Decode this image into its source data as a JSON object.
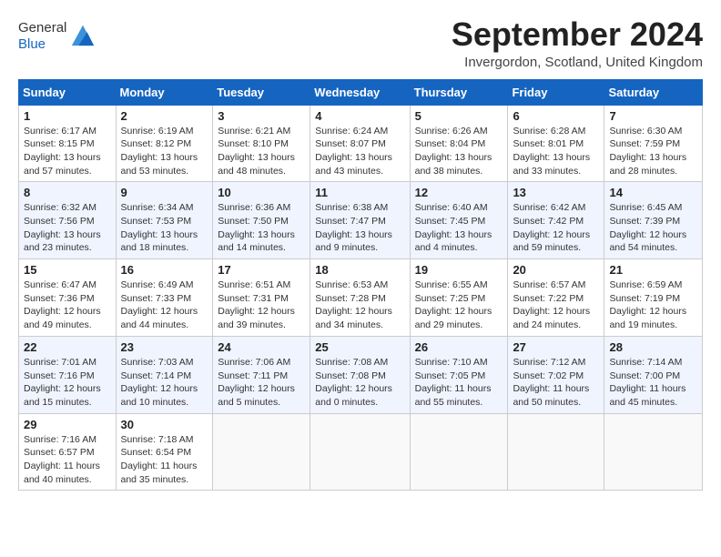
{
  "header": {
    "logo_general": "General",
    "logo_blue": "Blue",
    "title": "September 2024",
    "subtitle": "Invergordon, Scotland, United Kingdom"
  },
  "calendar": {
    "days_of_week": [
      "Sunday",
      "Monday",
      "Tuesday",
      "Wednesday",
      "Thursday",
      "Friday",
      "Saturday"
    ],
    "weeks": [
      [
        {
          "day": "1",
          "info": "Sunrise: 6:17 AM\nSunset: 8:15 PM\nDaylight: 13 hours\nand 57 minutes."
        },
        {
          "day": "2",
          "info": "Sunrise: 6:19 AM\nSunset: 8:12 PM\nDaylight: 13 hours\nand 53 minutes."
        },
        {
          "day": "3",
          "info": "Sunrise: 6:21 AM\nSunset: 8:10 PM\nDaylight: 13 hours\nand 48 minutes."
        },
        {
          "day": "4",
          "info": "Sunrise: 6:24 AM\nSunset: 8:07 PM\nDaylight: 13 hours\nand 43 minutes."
        },
        {
          "day": "5",
          "info": "Sunrise: 6:26 AM\nSunset: 8:04 PM\nDaylight: 13 hours\nand 38 minutes."
        },
        {
          "day": "6",
          "info": "Sunrise: 6:28 AM\nSunset: 8:01 PM\nDaylight: 13 hours\nand 33 minutes."
        },
        {
          "day": "7",
          "info": "Sunrise: 6:30 AM\nSunset: 7:59 PM\nDaylight: 13 hours\nand 28 minutes."
        }
      ],
      [
        {
          "day": "8",
          "info": "Sunrise: 6:32 AM\nSunset: 7:56 PM\nDaylight: 13 hours\nand 23 minutes."
        },
        {
          "day": "9",
          "info": "Sunrise: 6:34 AM\nSunset: 7:53 PM\nDaylight: 13 hours\nand 18 minutes."
        },
        {
          "day": "10",
          "info": "Sunrise: 6:36 AM\nSunset: 7:50 PM\nDaylight: 13 hours\nand 14 minutes."
        },
        {
          "day": "11",
          "info": "Sunrise: 6:38 AM\nSunset: 7:47 PM\nDaylight: 13 hours\nand 9 minutes."
        },
        {
          "day": "12",
          "info": "Sunrise: 6:40 AM\nSunset: 7:45 PM\nDaylight: 13 hours\nand 4 minutes."
        },
        {
          "day": "13",
          "info": "Sunrise: 6:42 AM\nSunset: 7:42 PM\nDaylight: 12 hours\nand 59 minutes."
        },
        {
          "day": "14",
          "info": "Sunrise: 6:45 AM\nSunset: 7:39 PM\nDaylight: 12 hours\nand 54 minutes."
        }
      ],
      [
        {
          "day": "15",
          "info": "Sunrise: 6:47 AM\nSunset: 7:36 PM\nDaylight: 12 hours\nand 49 minutes."
        },
        {
          "day": "16",
          "info": "Sunrise: 6:49 AM\nSunset: 7:33 PM\nDaylight: 12 hours\nand 44 minutes."
        },
        {
          "day": "17",
          "info": "Sunrise: 6:51 AM\nSunset: 7:31 PM\nDaylight: 12 hours\nand 39 minutes."
        },
        {
          "day": "18",
          "info": "Sunrise: 6:53 AM\nSunset: 7:28 PM\nDaylight: 12 hours\nand 34 minutes."
        },
        {
          "day": "19",
          "info": "Sunrise: 6:55 AM\nSunset: 7:25 PM\nDaylight: 12 hours\nand 29 minutes."
        },
        {
          "day": "20",
          "info": "Sunrise: 6:57 AM\nSunset: 7:22 PM\nDaylight: 12 hours\nand 24 minutes."
        },
        {
          "day": "21",
          "info": "Sunrise: 6:59 AM\nSunset: 7:19 PM\nDaylight: 12 hours\nand 19 minutes."
        }
      ],
      [
        {
          "day": "22",
          "info": "Sunrise: 7:01 AM\nSunset: 7:16 PM\nDaylight: 12 hours\nand 15 minutes."
        },
        {
          "day": "23",
          "info": "Sunrise: 7:03 AM\nSunset: 7:14 PM\nDaylight: 12 hours\nand 10 minutes."
        },
        {
          "day": "24",
          "info": "Sunrise: 7:06 AM\nSunset: 7:11 PM\nDaylight: 12 hours\nand 5 minutes."
        },
        {
          "day": "25",
          "info": "Sunrise: 7:08 AM\nSunset: 7:08 PM\nDaylight: 12 hours\nand 0 minutes."
        },
        {
          "day": "26",
          "info": "Sunrise: 7:10 AM\nSunset: 7:05 PM\nDaylight: 11 hours\nand 55 minutes."
        },
        {
          "day": "27",
          "info": "Sunrise: 7:12 AM\nSunset: 7:02 PM\nDaylight: 11 hours\nand 50 minutes."
        },
        {
          "day": "28",
          "info": "Sunrise: 7:14 AM\nSunset: 7:00 PM\nDaylight: 11 hours\nand 45 minutes."
        }
      ],
      [
        {
          "day": "29",
          "info": "Sunrise: 7:16 AM\nSunset: 6:57 PM\nDaylight: 11 hours\nand 40 minutes."
        },
        {
          "day": "30",
          "info": "Sunrise: 7:18 AM\nSunset: 6:54 PM\nDaylight: 11 hours\nand 35 minutes."
        },
        {
          "day": "",
          "info": ""
        },
        {
          "day": "",
          "info": ""
        },
        {
          "day": "",
          "info": ""
        },
        {
          "day": "",
          "info": ""
        },
        {
          "day": "",
          "info": ""
        }
      ]
    ]
  }
}
